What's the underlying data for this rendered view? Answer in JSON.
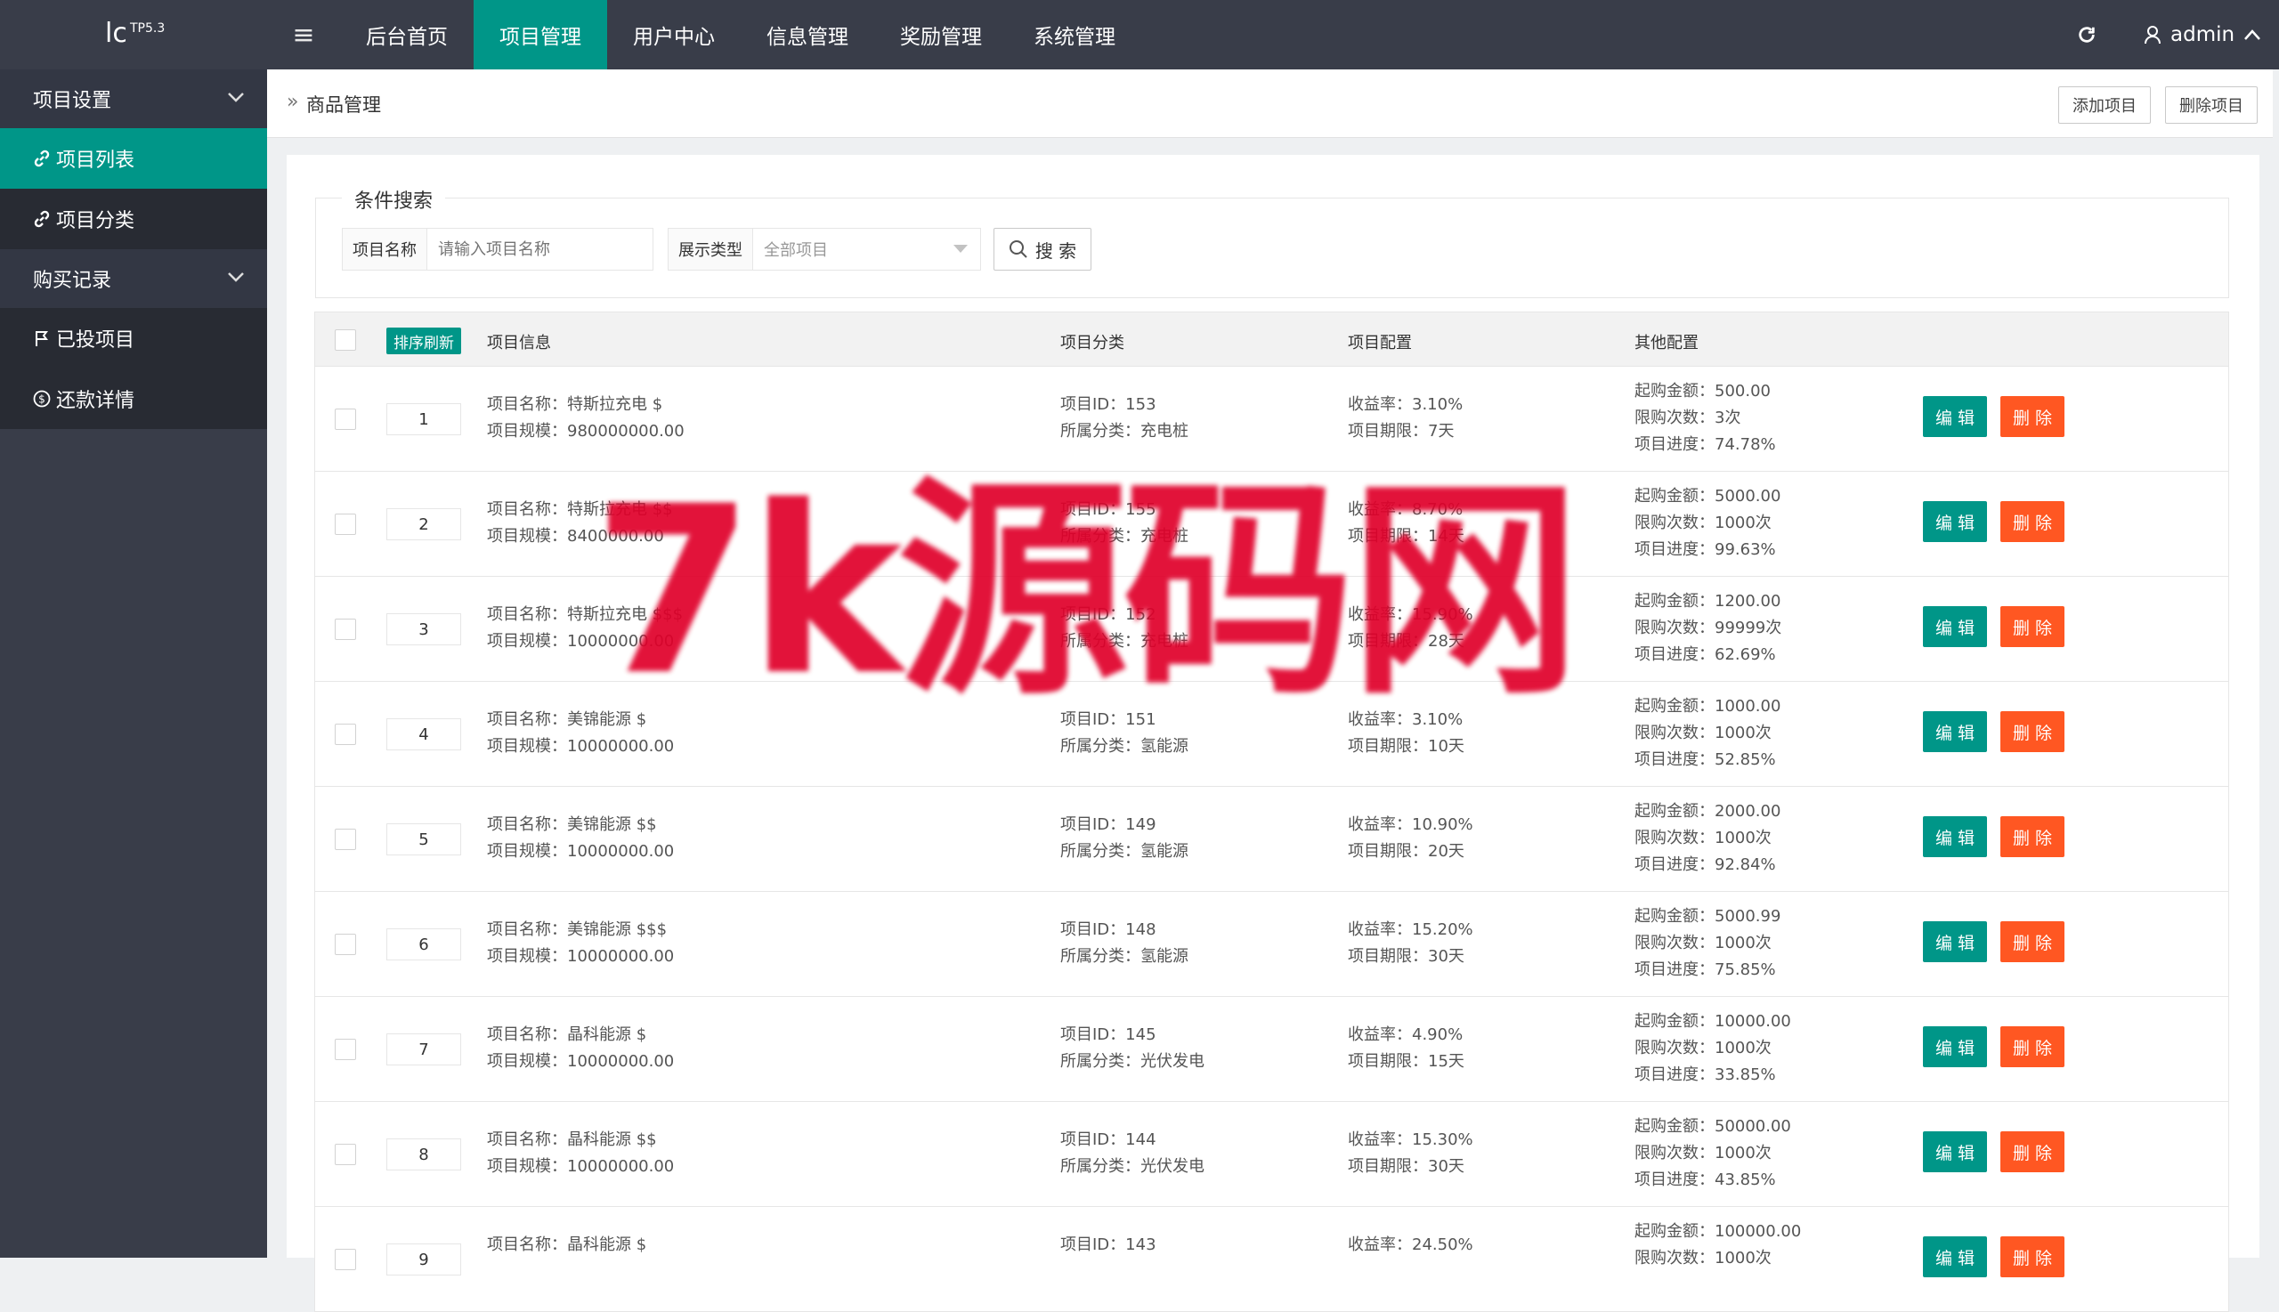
{
  "header": {
    "logo_main": "lc",
    "logo_sub": "TP5.3",
    "menu_icon": "≡",
    "nav": [
      {
        "label": "后台首页",
        "active": false
      },
      {
        "label": "项目管理",
        "active": true
      },
      {
        "label": "用户中心",
        "active": false
      },
      {
        "label": "信息管理",
        "active": false
      },
      {
        "label": "奖励管理",
        "active": false
      },
      {
        "label": "系统管理",
        "active": false
      }
    ],
    "refresh_icon": "refresh-icon",
    "user": "admin"
  },
  "sidebar": {
    "groups": [
      {
        "label": "项目设置",
        "items": [
          {
            "label": "项目列表",
            "icon": "link-icon",
            "active": true
          },
          {
            "label": "项目分类",
            "icon": "link-icon",
            "active": false
          }
        ]
      },
      {
        "label": "购买记录",
        "items": [
          {
            "label": "已投项目",
            "icon": "flag-icon",
            "active": false
          },
          {
            "label": "还款详情",
            "icon": "dollar-icon",
            "active": false
          }
        ]
      }
    ]
  },
  "breadcrumb": {
    "text": "商品管理",
    "add_button": "添加项目",
    "delete_button": "删除项目"
  },
  "search": {
    "legend": "条件搜索",
    "name_label": "项目名称",
    "name_placeholder": "请输入项目名称",
    "type_label": "展示类型",
    "type_value": "全部项目",
    "button": "搜 索"
  },
  "table": {
    "sort_refresh": "排序刷新",
    "headers": [
      "项目信息",
      "项目分类",
      "项目配置",
      "其他配置"
    ],
    "edit_label": "编 辑",
    "delete_label": "删 除",
    "rows": [
      {
        "sort": "1",
        "name": "项目名称：特斯拉充电 $",
        "scale": "项目规模：980000000.00",
        "id": "项目ID：153",
        "category": "所属分类：充电桩",
        "yield": "收益率：3.10%",
        "period": "项目期限：7天",
        "min": "起购金额：500.00",
        "limit": "限购次数：3次",
        "progress": "项目进度：74.78%"
      },
      {
        "sort": "2",
        "name": "项目名称：特斯拉充电 $$",
        "scale": "项目规模：8400000.00",
        "id": "项目ID：155",
        "category": "所属分类：充电桩",
        "yield": "收益率：8.70%",
        "period": "项目期限：14天",
        "min": "起购金额：5000.00",
        "limit": "限购次数：1000次",
        "progress": "项目进度：99.63%"
      },
      {
        "sort": "3",
        "name": "项目名称：特斯拉充电 $$$",
        "scale": "项目规模：10000000.00",
        "id": "项目ID：152",
        "category": "所属分类：充电桩",
        "yield": "收益率：15.90%",
        "period": "项目期限：28天",
        "min": "起购金额：1200.00",
        "limit": "限购次数：99999次",
        "progress": "项目进度：62.69%"
      },
      {
        "sort": "4",
        "name": "项目名称：美锦能源 $",
        "scale": "项目规模：10000000.00",
        "id": "项目ID：151",
        "category": "所属分类：氢能源",
        "yield": "收益率：3.10%",
        "period": "项目期限：10天",
        "min": "起购金额：1000.00",
        "limit": "限购次数：1000次",
        "progress": "项目进度：52.85%"
      },
      {
        "sort": "5",
        "name": "项目名称：美锦能源 $$",
        "scale": "项目规模：10000000.00",
        "id": "项目ID：149",
        "category": "所属分类：氢能源",
        "yield": "收益率：10.90%",
        "period": "项目期限：20天",
        "min": "起购金额：2000.00",
        "limit": "限购次数：1000次",
        "progress": "项目进度：92.84%"
      },
      {
        "sort": "6",
        "name": "项目名称：美锦能源 $$$",
        "scale": "项目规模：10000000.00",
        "id": "项目ID：148",
        "category": "所属分类：氢能源",
        "yield": "收益率：15.20%",
        "period": "项目期限：30天",
        "min": "起购金额：5000.99",
        "limit": "限购次数：1000次",
        "progress": "项目进度：75.85%"
      },
      {
        "sort": "7",
        "name": "项目名称：晶科能源 $",
        "scale": "项目规模：10000000.00",
        "id": "项目ID：145",
        "category": "所属分类：光伏发电",
        "yield": "收益率：4.90%",
        "period": "项目期限：15天",
        "min": "起购金额：10000.00",
        "limit": "限购次数：1000次",
        "progress": "项目进度：33.85%"
      },
      {
        "sort": "8",
        "name": "项目名称：晶科能源 $$",
        "scale": "项目规模：10000000.00",
        "id": "项目ID：144",
        "category": "所属分类：光伏发电",
        "yield": "收益率：15.30%",
        "period": "项目期限：30天",
        "min": "起购金额：50000.00",
        "limit": "限购次数：1000次",
        "progress": "项目进度：43.85%"
      },
      {
        "sort": "9",
        "name": "项目名称：晶科能源 $",
        "scale": "",
        "id": "项目ID：143",
        "category": "",
        "yield": "收益率：24.50%",
        "period": "",
        "min": "起购金额：100000.00",
        "limit": "限购次数：1000次",
        "progress": ""
      }
    ]
  },
  "watermark": "7k源码网"
}
